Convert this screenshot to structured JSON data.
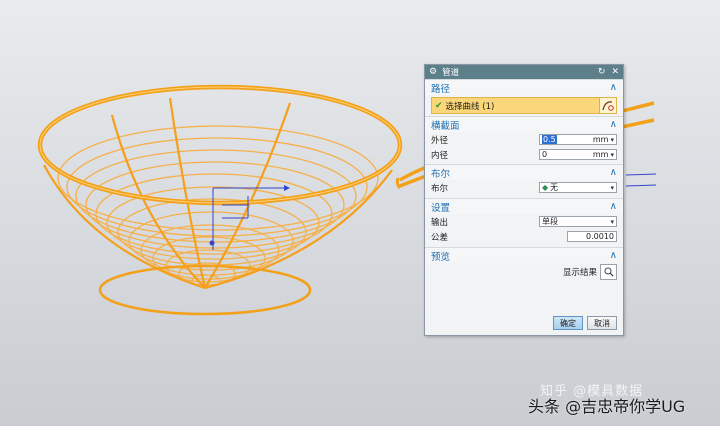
{
  "dialog": {
    "title": "管道",
    "sections": {
      "path": {
        "title": "路径",
        "select_curve": "选择曲线 (1)"
      },
      "cross_section": {
        "title": "横截面",
        "outer_label": "外径",
        "outer_value": "0.5",
        "outer_unit": "mm",
        "inner_label": "内径",
        "inner_value": "0",
        "inner_unit": "mm"
      },
      "boolean": {
        "title": "布尔",
        "label": "布尔",
        "value": "无"
      },
      "settings": {
        "title": "设置",
        "output_label": "输出",
        "output_value": "单段",
        "tolerance_label": "公差",
        "tolerance_value": "0.0010"
      },
      "preview": {
        "title": "预览",
        "show_result": "显示结果"
      }
    },
    "ok_label": "确定",
    "cancel_label": "取消"
  },
  "watermark": {
    "line1": "知乎 @模具数据",
    "line2": "头条 @吉忠帝你学UG"
  },
  "colors": {
    "model": "#f5a623",
    "title_bar": "#5c7f8a",
    "section_title": "#1f6fb2",
    "selection_highlight": "#fbd77a"
  }
}
